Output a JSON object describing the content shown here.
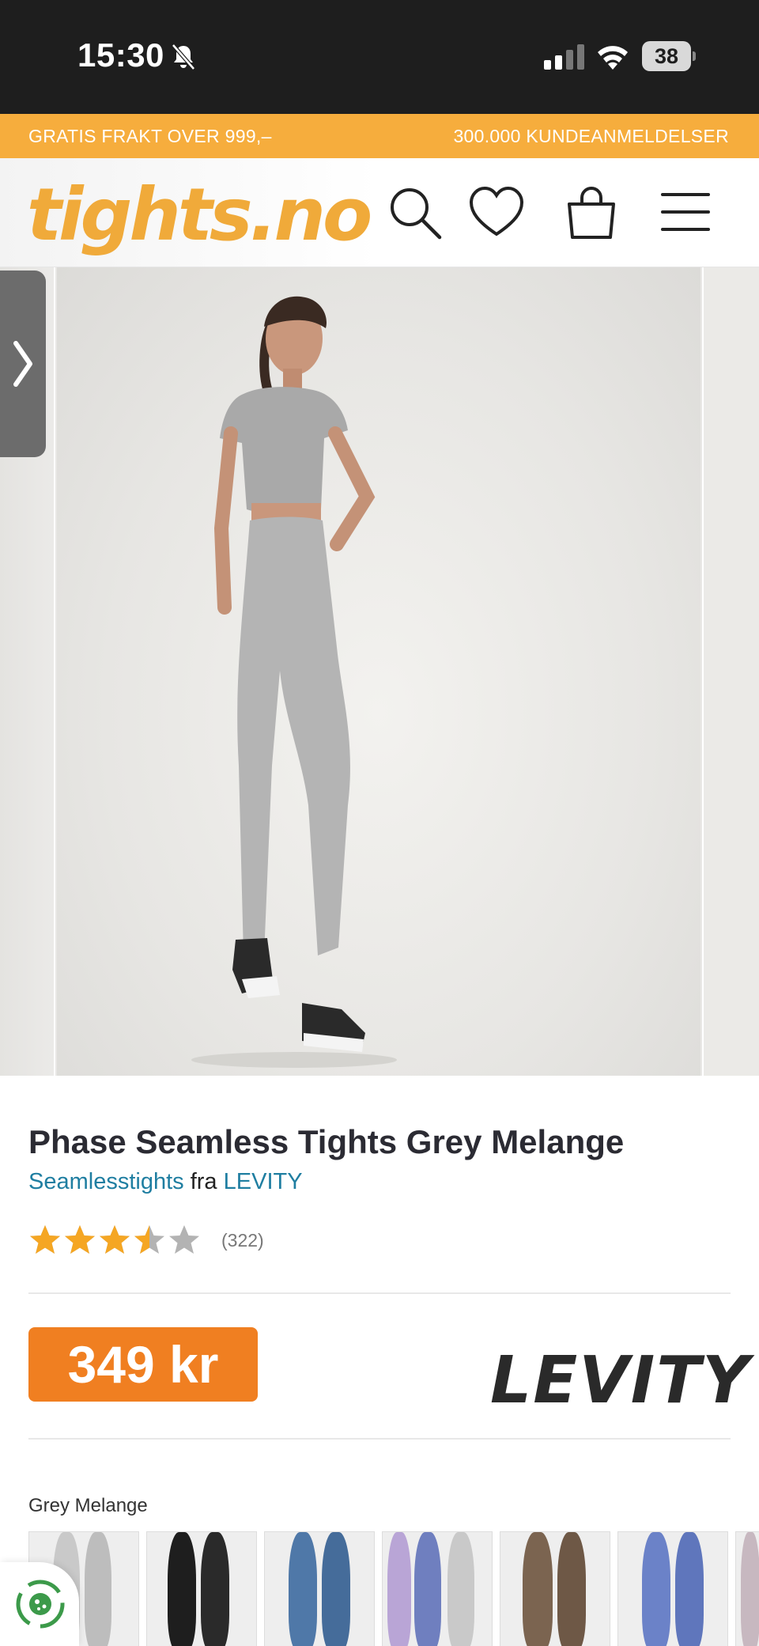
{
  "status_bar": {
    "time": "15:30",
    "battery": "38"
  },
  "promo_bar": {
    "left_text": "GRATIS FRAKT OVER 999,–",
    "right_text": "300.000 KUNDEANMELDELSER",
    "background": "#f6ad3d"
  },
  "header": {
    "logo": "tights.no",
    "logo_color": "#f0aa3a",
    "icons": [
      "search-icon",
      "heart-icon",
      "bag-icon",
      "menu-icon"
    ]
  },
  "gallery": {
    "prev_control": "chevron-right-icon"
  },
  "product": {
    "title": "Phase Seamless Tights Grey Melange",
    "category_link": "Seamlesstights",
    "from_word": "fra",
    "brand_link": "LEVITY",
    "rating_value": 3.5,
    "rating_max": 5,
    "review_count": "(322)",
    "price": "349 kr",
    "price_color": "#f07f21",
    "brand_logo": "LEVITY",
    "color_label": "Grey Melange",
    "swatch_count": 7
  }
}
